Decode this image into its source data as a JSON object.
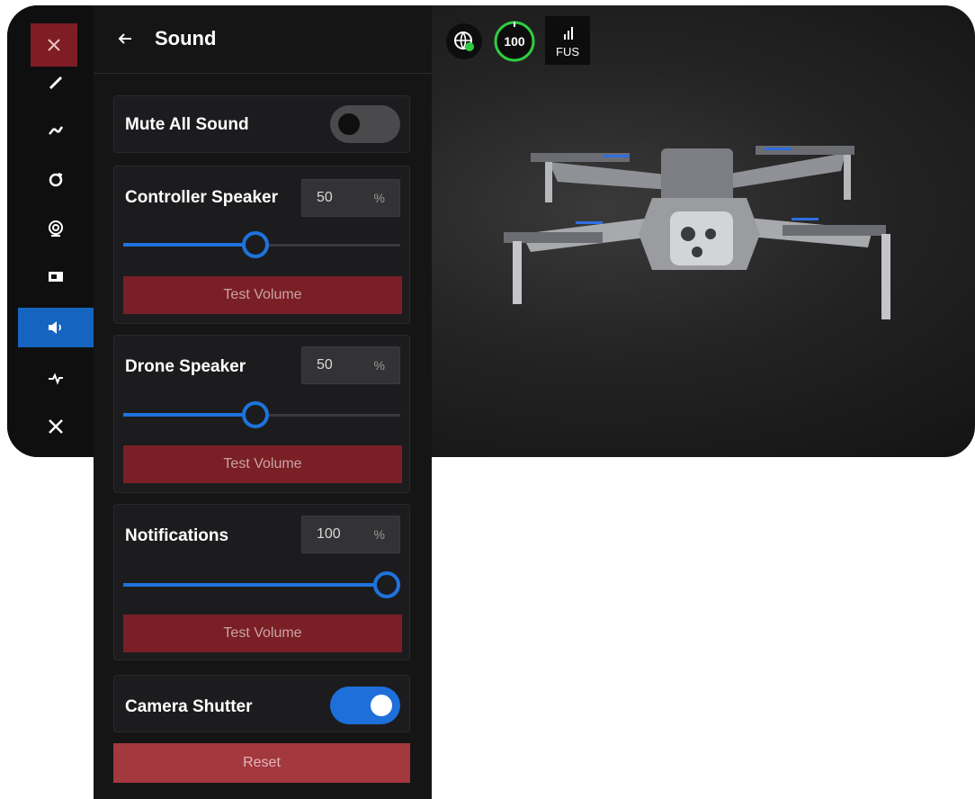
{
  "colors": {
    "accent_blue": "#1e73dc",
    "danger_red": "#7a1f25",
    "reset_red": "#a3383f",
    "battery_green": "#2ecc40"
  },
  "rail": {
    "close_icon": "close-icon",
    "items": [
      {
        "icon": "pen-icon"
      },
      {
        "icon": "flight-icon"
      },
      {
        "icon": "sync-icon"
      },
      {
        "icon": "at-sign-icon"
      },
      {
        "icon": "display-icon"
      },
      {
        "icon": "speaker-icon",
        "active": true
      },
      {
        "icon": "pulse-icon"
      },
      {
        "icon": "tools-icon"
      }
    ]
  },
  "panel": {
    "title": "Sound",
    "mute_label": "Mute All Sound",
    "mute_on": false,
    "controller_label": "Controller Speaker",
    "controller_value": "50",
    "controller_level": 0.5,
    "drone_label": "Drone Speaker",
    "drone_value": "50",
    "drone_level": 0.5,
    "notifications_label": "Notifications",
    "notifications_value": "100",
    "notifications_level": 1.0,
    "unit": "%",
    "test_label": "Test Volume",
    "shutter_label": "Camera Shutter",
    "shutter_on": true,
    "reset_label": "Reset"
  },
  "status": {
    "battery": "100",
    "signal_label": "FUS"
  }
}
